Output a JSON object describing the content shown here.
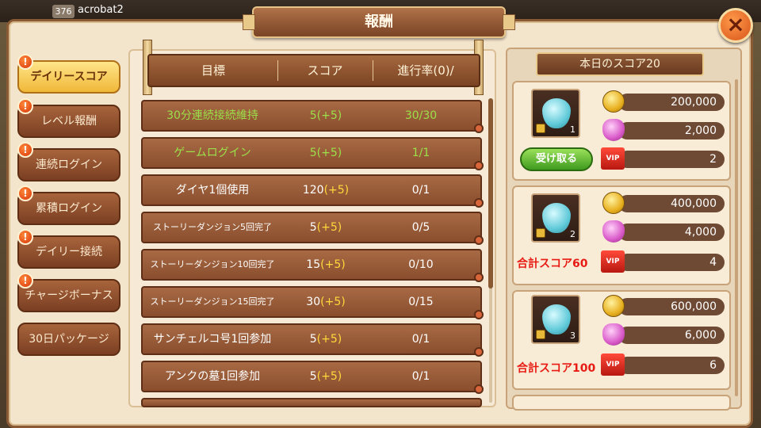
{
  "player": {
    "level": "376",
    "name": "acrobat2"
  },
  "window": {
    "title": "報酬",
    "close_icon": "×"
  },
  "tabs": [
    {
      "label": "デイリースコア",
      "active": true
    },
    {
      "label": "レベル報酬"
    },
    {
      "label": "連続ログイン"
    },
    {
      "label": "累積ログイン"
    },
    {
      "label": "デイリー接続"
    },
    {
      "label": "チャージボーナス"
    },
    {
      "label": "30日パッケージ"
    }
  ],
  "badge_text": "!",
  "table": {
    "headers": {
      "goal": "目標",
      "score": "スコア",
      "progress": "進行率(0)/"
    },
    "rows": [
      {
        "goal": "30分連続接続維持",
        "score_base": "5",
        "score_bonus": "(+5)",
        "progress": "30/30",
        "done": true
      },
      {
        "goal": "ゲームログイン",
        "score_base": "5",
        "score_bonus": "(+5)",
        "progress": "1/1",
        "done": true
      },
      {
        "goal": "ダイヤ1個使用",
        "score_base": "120",
        "score_bonus": "(+5)",
        "progress": "0/1"
      },
      {
        "goal": "ストーリーダンジョン5回完了",
        "score_base": "5",
        "score_bonus": "(+5)",
        "progress": "0/5"
      },
      {
        "goal": "ストーリーダンジョン10回完了",
        "score_base": "15",
        "score_bonus": "(+5)",
        "progress": "0/10"
      },
      {
        "goal": "ストーリーダンジョン15回完了",
        "score_base": "30",
        "score_bonus": "(+5)",
        "progress": "0/15"
      },
      {
        "goal": "サンチェルコ号1回参加",
        "score_base": "5",
        "score_bonus": "(+5)",
        "progress": "0/1"
      },
      {
        "goal": "アンクの墓1回参加",
        "score_base": "5",
        "score_bonus": "(+5)",
        "progress": "0/1"
      }
    ]
  },
  "rewards": {
    "header": "本日のスコア20",
    "vip_label": "VIP",
    "cards": [
      {
        "tier": "1",
        "gold": "200,000",
        "gems": "2,000",
        "vip": "2",
        "claim_label": "受け取る"
      },
      {
        "tier": "2",
        "gold": "400,000",
        "gems": "4,000",
        "vip": "4",
        "requirement": "合計スコア60"
      },
      {
        "tier": "3",
        "gold": "600,000",
        "gems": "6,000",
        "vip": "6",
        "requirement": "合計スコア100"
      }
    ]
  }
}
